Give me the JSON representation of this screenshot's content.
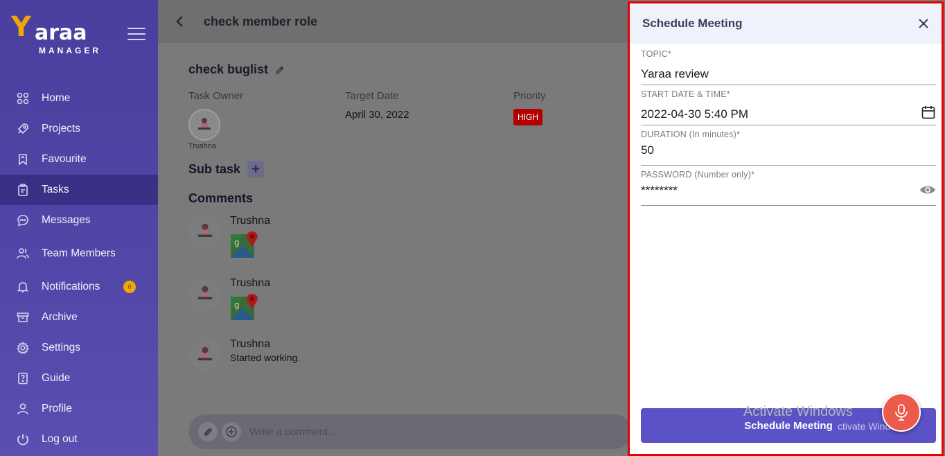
{
  "brand": {
    "logo_letter": "Y",
    "logo_rest": "araa",
    "logo_sub": "MANAGER"
  },
  "sidebar": {
    "items": [
      {
        "label": "Home",
        "icon": "grid-icon"
      },
      {
        "label": "Projects",
        "icon": "rocket-icon"
      },
      {
        "label": "Favourite",
        "icon": "bookmark-icon"
      },
      {
        "label": "Tasks",
        "icon": "clipboard-icon",
        "active": true
      },
      {
        "label": "Messages",
        "icon": "chat-icon"
      },
      {
        "label": "Team Members",
        "icon": "people-icon"
      },
      {
        "label": "Notifications",
        "icon": "bell-icon",
        "badge": "0"
      },
      {
        "label": "Archive",
        "icon": "archive-icon"
      },
      {
        "label": "Settings",
        "icon": "gear-icon"
      },
      {
        "label": "Guide",
        "icon": "guide-icon"
      },
      {
        "label": "Profile",
        "icon": "user-icon"
      },
      {
        "label": "Log out",
        "icon": "power-icon"
      }
    ]
  },
  "header": {
    "title": "check member role"
  },
  "task": {
    "title": "check buglist",
    "owner_label": "Task Owner",
    "owner_name": "Trushna",
    "target_date_label": "Target Date",
    "target_date": "April 30, 2022",
    "priority_label": "Priority",
    "priority": "HIGH",
    "subtask_label": "Sub task",
    "comments_label": "Comments"
  },
  "comments": [
    {
      "author": "Trushna",
      "text": ""
    },
    {
      "author": "Trushna",
      "text": ""
    },
    {
      "author": "Trushna",
      "text": "Started working."
    }
  ],
  "comment_input": {
    "placeholder": "Write a comment..."
  },
  "modal": {
    "title": "Schedule Meeting",
    "fields": {
      "topic": {
        "label": "TOPIC*",
        "value": "Yaraa review"
      },
      "start": {
        "label": "START DATE & TIME*",
        "value": "2022-04-30 5:40 PM"
      },
      "duration": {
        "label": "DURATION (In minutes)*",
        "value": "50"
      },
      "password": {
        "label": "PASSWORD (Number only)*",
        "value": "********"
      }
    },
    "submit_label": "Schedule Meeting"
  },
  "watermark": {
    "line1": "Activate Windows",
    "line2": "ctivate Window"
  },
  "colors": {
    "accent": "#5b52c8",
    "sidebar": "#4a3f9e",
    "priority": "#b20000",
    "highlight_border": "#e60000",
    "badge": "#f0a800",
    "mic": "#ec5a4a"
  }
}
